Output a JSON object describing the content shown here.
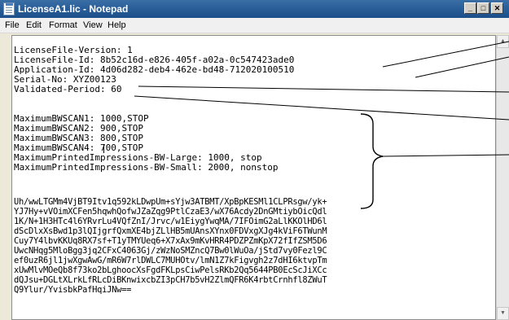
{
  "window": {
    "title": "LicenseA1.lic - Notepad",
    "minimize_symbol": "_",
    "maximize_symbol": "□",
    "close_symbol": "✕"
  },
  "menu": {
    "items": [
      "File",
      "Edit",
      "Format",
      "View",
      "Help"
    ]
  },
  "document": {
    "lines": [
      "LicenseFile-Version: 1",
      "LicenseFile-Id: 8b52c16d-e826-405f-a02a-0c547423ade0",
      "Application-Id: 4d06d282-deb4-462e-bd48-712020100510",
      "Serial-No: XYZ00123",
      "Validated-Period: 60",
      "",
      "MaximumBWSCAN1: 1000,STOP",
      "MaximumBWSCAN2: 900,STOP",
      "MaximumBWSCAN3: 800,STOP",
      "MaximumBWSCAN4: 700,STOP",
      "MaximumPrintedImpressions-BW-Large: 1000, stop",
      "MaximumPrintedImpressions-BW-Small: 2000, nonstop",
      "",
      "Uh/wwLTGMm4VjBT9Itv1q592kLDwpUm+sYjw3ATBMT/XpBpKESMl1CLPRsgw/yk+",
      "YJ7Hy+vVOimXCFen5hqwhQofwJZaZqg9PtlCzaE3/wX76Acdy2DnGMtiybOicQdl",
      "1K/N+1H3HTc4l6YRvrLu4VQfZnI/Jrvc/w1EiygYwqMA/7IFOimG2aLlKKOlHD6l",
      "dScDlxXsBwd1p3lQIjgrfQxmXE4bjZLlHB5mUAnsXYnx0FDVxgXJg4kViF6TWunM",
      "Cuy7Y4lbvKKUq8RX7sf+T1yTMYUeq6+X7xAx9mKvHRR4PDZPZmKpX72fIfZSM5D6",
      "UwcNHqg5MloBgg3jq2CFxC4063Gj/zWzNoSMZncQ7Bw0lWuOa/jStd7vy0Fezl9C",
      "ef0uzR6jl1jwXgwAwG/mR6W7rlDWLC7MUHOtv/lmN1Z7kFigvgh2z7dHI6ktvpTm",
      "xUwMlvMOeQb8f73ko2bLghoocXsFgdFKLpsCiwPelsRKb2Qq5644PB0EcScJiXCc",
      "dQJsu+DGLtXLrkLfRLcDiBKnwixcbZI3pCH7b5vH2ZlmQFR6K4rbtCrnhfl8ZWuT",
      "Q9Ylur/YvisbkPafHqiJNw=="
    ]
  }
}
